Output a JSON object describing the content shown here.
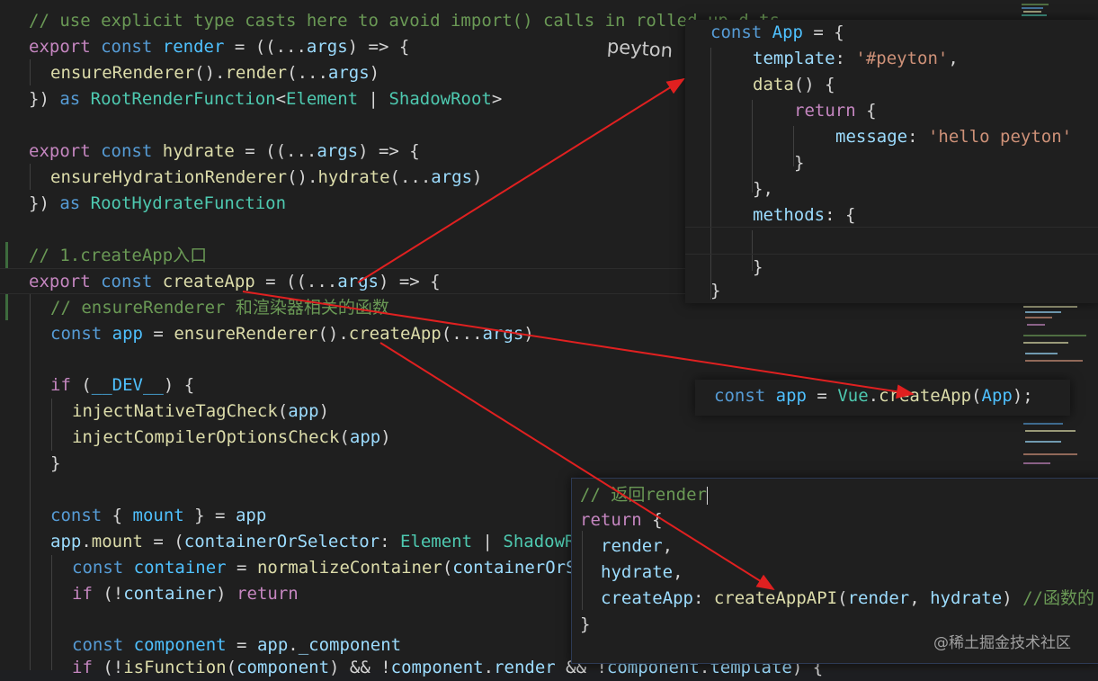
{
  "editor": {
    "lines": {
      "l1": "// use explicit type casts here to avoid import() calls in rolled-up d.ts",
      "l2_export": "export",
      "l2_const": "const",
      "l2_render": "render",
      "l2_rest": " = ((...",
      "l2_args": "args",
      "l2_end": ") => {",
      "l3_fn": "ensureRenderer",
      "l3_mid": "().",
      "l3_render": "render",
      "l3_open": "(...",
      "l3_args": "args",
      "l3_close": ")",
      "l4_open": "}) ",
      "l4_as": "as",
      "l4_type": "RootRenderFunction",
      "l4_lt": "<",
      "l4_el": "Element",
      "l4_bar": " | ",
      "l4_sr": "ShadowRoot",
      "l4_gt": ">",
      "l6_export": "export",
      "l6_const": "const",
      "l6_name": "hydrate",
      "l6_rest": " = ((...",
      "l6_args": "args",
      "l6_end": ") => {",
      "l7_fn": "ensureHydrationRenderer",
      "l7_mid": "().",
      "l7_call": "hydrate",
      "l7_open": "(...",
      "l7_args": "args",
      "l7_close": ")",
      "l8_open": "}) ",
      "l8_as": "as",
      "l8_type": "RootHydrateFunction",
      "l10": "// 1.createApp入口",
      "l11_export": "export",
      "l11_const": "const",
      "l11_name": "createApp",
      "l11_rest": " = ((...",
      "l11_args": "args",
      "l11_end": ") => {",
      "l12": "// ensureRenderer 和渲染器相关的函数",
      "l13_const": "const",
      "l13_app": "app",
      "l13_eq": " = ",
      "l13_fn": "ensureRenderer",
      "l13_mid": "().",
      "l13_call": "createApp",
      "l13_open": "(...",
      "l13_args": "args",
      "l13_close": ")",
      "l15_if": "if",
      "l15_open": " (",
      "l15_dev": "__DEV__",
      "l15_close": ") {",
      "l16_fn": "injectNativeTagCheck",
      "l16_open": "(",
      "l16_app": "app",
      "l16_close": ")",
      "l17_fn": "injectCompilerOptionsCheck",
      "l17_open": "(",
      "l17_app": "app",
      "l17_close": ")",
      "l18": "}",
      "l20_const": "const",
      "l20_open": " { ",
      "l20_mount": "mount",
      "l20_close": " } = ",
      "l20_app": "app",
      "l21_app": "app",
      "l21_dot": ".",
      "l21_mount": "mount",
      "l21_eq": " = (",
      "l21_param": "containerOrSelector",
      "l21_colon": ": ",
      "l21_el": "Element",
      "l21_bar": " | ",
      "l21_sr": "ShadowRoot",
      "l22_const": "const",
      "l22_var": "container",
      "l22_eq": " = ",
      "l22_fn": "normalizeContainer",
      "l22_open": "(",
      "l22_param": "containerOrSelector",
      "l23_if": "if",
      "l23_open": " (!",
      "l23_var": "container",
      "l23_close": ") ",
      "l23_ret": "return",
      "l25_const": "const",
      "l25_var": "component",
      "l25_eq": " = ",
      "l25_app": "app",
      "l25_dot": ".",
      "l25_prop": "_component",
      "l26_if": "if",
      "l26_open": " (!",
      "l26_fn": "isFunction",
      "l26_p": "(",
      "l26_comp": "component",
      "l26_mid": ") && !",
      "l26_comp2": "component",
      "l26_dot": ".",
      "l26_render": "render",
      "l26_and": " && !",
      "l26_comp3": "component",
      "l26_dot2": ".",
      "l26_tpl": "template",
      "l26_end": ") {"
    }
  },
  "popup_app": {
    "p1_const": "const",
    "p1_name": "App",
    "p1_rest": " = {",
    "p2_key": "template",
    "p2_colon": ": ",
    "p2_val": "'#peyton'",
    "p2_comma": ",",
    "p3_fn": "data",
    "p3_rest": "() {",
    "p4_ret": "return",
    "p4_rest": " {",
    "p5_key": "message",
    "p5_colon": ": ",
    "p5_val": "'hello peyton'",
    "p6": "}",
    "p7": "},",
    "p8_key": "methods",
    "p8_rest": ": {",
    "p10": "}",
    "p11": "}"
  },
  "popup_create": {
    "c_const": "const",
    "c_app": "app",
    "c_eq": " = ",
    "c_vue": "Vue",
    "c_dot": ".",
    "c_fn": "createApp",
    "c_open": "(",
    "c_arg": "App",
    "c_close": ");"
  },
  "popup_return": {
    "r1": "// 返回render",
    "r2_ret": "return",
    "r2_rest": " {",
    "r3_var": "render",
    "r3_comma": ",",
    "r4_var": "hydrate",
    "r4_comma": ",",
    "r5_key": "createApp",
    "r5_colon": ": ",
    "r5_fn": "createAppAPI",
    "r5_open": "(",
    "r5_a1": "render",
    "r5_sep": ", ",
    "r5_a2": "hydrate",
    "r5_close": ") ",
    "r5_com": "//函数的",
    "r6": "}"
  },
  "annotation": {
    "handwritten": "peyton"
  },
  "watermark": {
    "text": "@稀土掘金技术社区"
  },
  "colors": {
    "arrow": "#e02020",
    "background": "#1f1f1f"
  }
}
